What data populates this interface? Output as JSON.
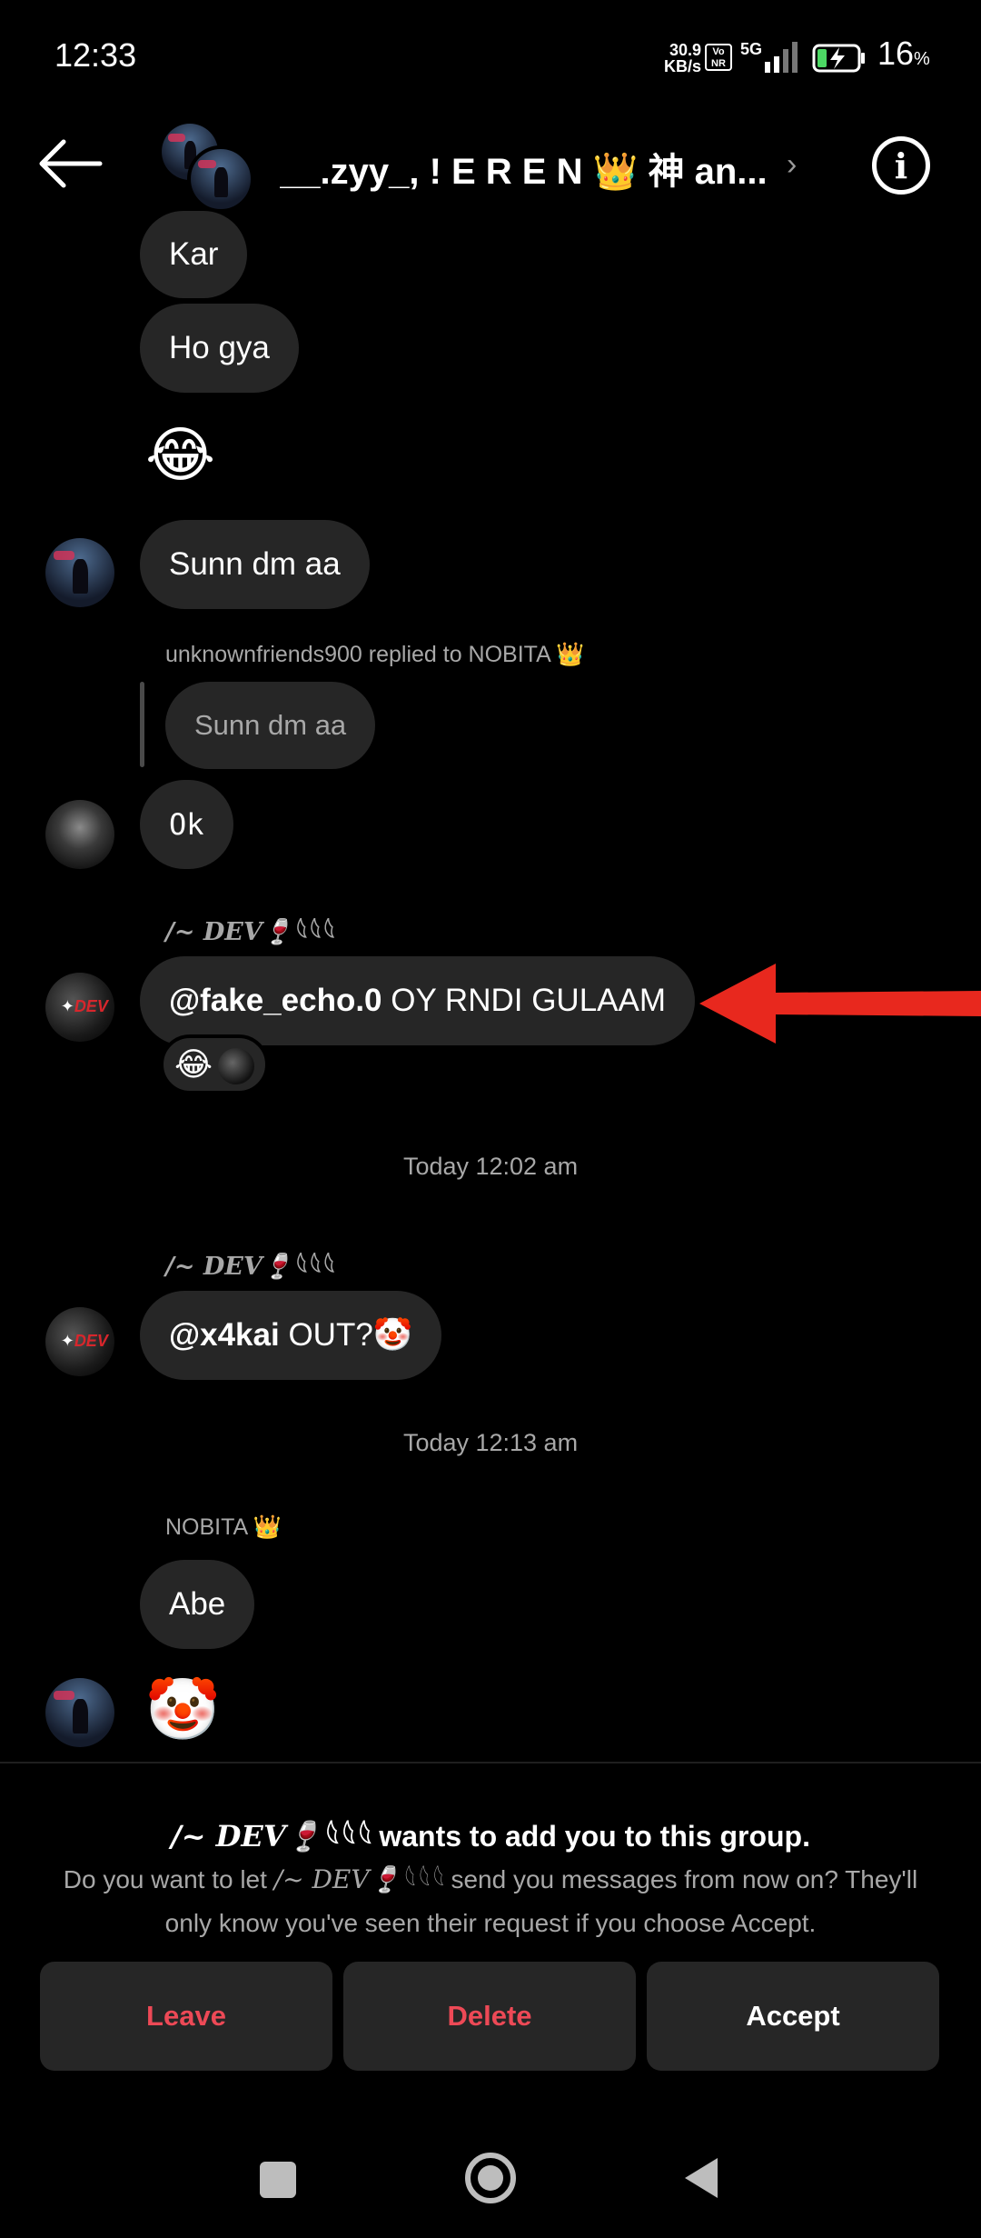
{
  "status_bar": {
    "time": "12:33",
    "net_speed_value": "30.9",
    "net_speed_unit": "KB/s",
    "vonr_top": "Vo",
    "vonr_bottom": "NR",
    "network": "5G",
    "battery_value": "16",
    "battery_unit": "%"
  },
  "header": {
    "group_name": "__.zyy_, ! E R E N 👑 神 an...",
    "back_icon": "arrow-left-icon",
    "info_icon": "info-icon",
    "info_glyph": "i",
    "chevron": "›"
  },
  "messages": {
    "m1": "Kar",
    "m2": "Ho gya",
    "m3": "😂",
    "m4": "Sunn dm aa",
    "reply_caption": "unknownfriends900 replied to NOBITA 👑",
    "reply_quote": "Sunn dm aa",
    "m5": "Ok",
    "dev_sender_1": "/~ DEV🍷𓆩𓆩𓆩",
    "m6_mention": "@fake_echo.0",
    "m6_text": " OY RNDI GULAAM",
    "m6_reaction": "😂",
    "timestamp_1": "Today 12:02 am",
    "dev_sender_2": "/~ DEV🍷𓆩𓆩𓆩",
    "m7_mention": "@x4kai",
    "m7_text": " OUT?🤡",
    "timestamp_2": "Today 12:13 am",
    "nobita_sender": "NOBITA 👑",
    "m8": "Abe",
    "m9": "🤡"
  },
  "request": {
    "name": "/~ DEV🍷𓆩𓆩𓆩",
    "title_suffix": " wants to add you to this group.",
    "desc_prefix": "Do you want to let ",
    "desc_name": "/~ DEV🍷𓆩𓆩𓆩",
    "desc_suffix": " send you messages from now on? They'll only know you've seen their request if you choose Accept.",
    "leave": "Leave",
    "delete": "Delete",
    "accept": "Accept"
  },
  "colors": {
    "bubble": "#262626",
    "danger": "#ed4956",
    "arrow": "#e8281e"
  }
}
